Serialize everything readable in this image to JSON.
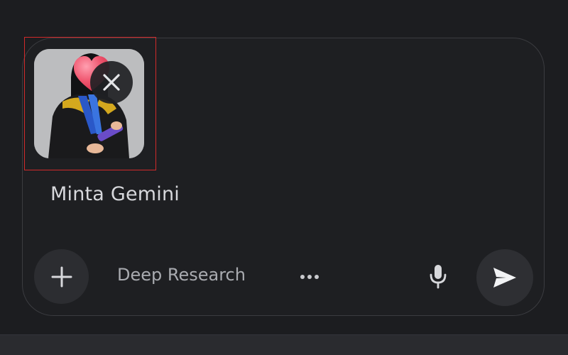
{
  "composer": {
    "placeholder": "Minta Gemini",
    "deep_research_label": "Deep Research"
  },
  "attachment": {
    "type": "image",
    "highlighted": true
  },
  "icons": {
    "add": "plus-icon",
    "more": "more-horizontal-icon",
    "mic": "microphone-icon",
    "send": "send-icon",
    "remove": "close-icon",
    "sticker": "heart-icon"
  },
  "colors": {
    "background": "#1c1d20",
    "composer_border": "#3b3c40",
    "button_bg": "#2c2d31",
    "text_primary": "#d7d8dc",
    "text_secondary": "#a9abb0",
    "highlight": "#d12a2a",
    "heart": "#f0566f"
  }
}
